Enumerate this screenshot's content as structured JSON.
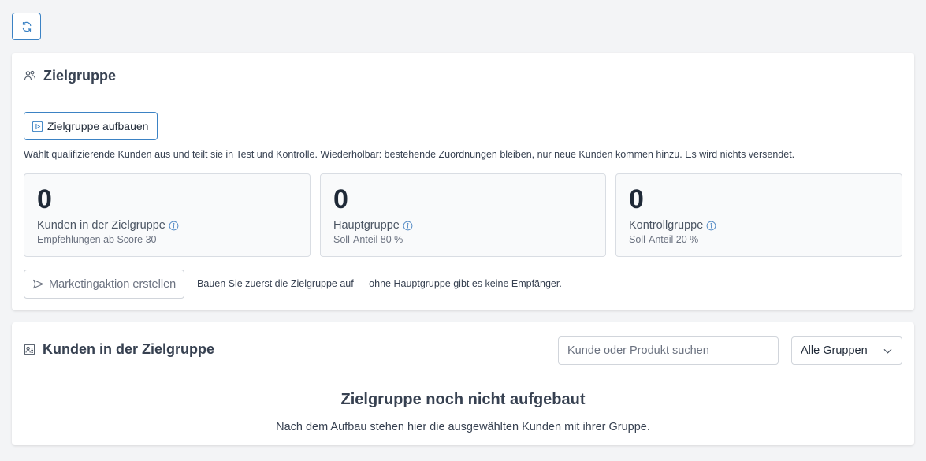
{
  "toolbar": {
    "refresh_icon": "refresh-icon"
  },
  "audience_card": {
    "title": "Zielgruppe",
    "icon": "users-icon",
    "build_button": {
      "label": "Zielgruppe aufbauen",
      "icon": "play-square-icon"
    },
    "description": "Wählt qualifizierende Kunden aus und teilt sie in Test und Kontrolle. Wiederholbar: bestehende Zuordnungen bleiben, nur neue Kunden kommen hinzu. Es wird nichts versendet.",
    "stats": [
      {
        "value": "0",
        "label": "Kunden in der Zielgruppe",
        "sub": "Empfehlungen ab Score 30",
        "info_icon": "info-icon"
      },
      {
        "value": "0",
        "label": "Hauptgruppe",
        "sub": "Soll-Anteil 80 %",
        "info_icon": "info-icon"
      },
      {
        "value": "0",
        "label": "Kontrollgruppe",
        "sub": "Soll-Anteil 20 %",
        "info_icon": "info-icon"
      }
    ],
    "campaign_button": {
      "label": "Marketingaktion erstellen",
      "icon": "send-icon",
      "disabled": true
    },
    "campaign_hint": "Bauen Sie zuerst die Zielgruppe auf — ohne Hauptgruppe gibt es keine Empfänger."
  },
  "customers_card": {
    "title": "Kunden in der Zielgruppe",
    "icon": "user-list-icon",
    "search": {
      "placeholder": "Kunde oder Produkt suchen",
      "value": ""
    },
    "filter": {
      "selected": "Alle Gruppen",
      "icon": "chevron-down-icon"
    },
    "empty_title": "Zielgruppe noch nicht aufgebaut",
    "empty_text": "Nach dem Aufbau stehen hier die ausgewählten Kunden mit ihrer Gruppe."
  },
  "colors": {
    "accent": "#3b82c4",
    "info": "#5b8fc7",
    "text": "#374151",
    "muted": "#6b7280",
    "border": "#d1d5db"
  }
}
